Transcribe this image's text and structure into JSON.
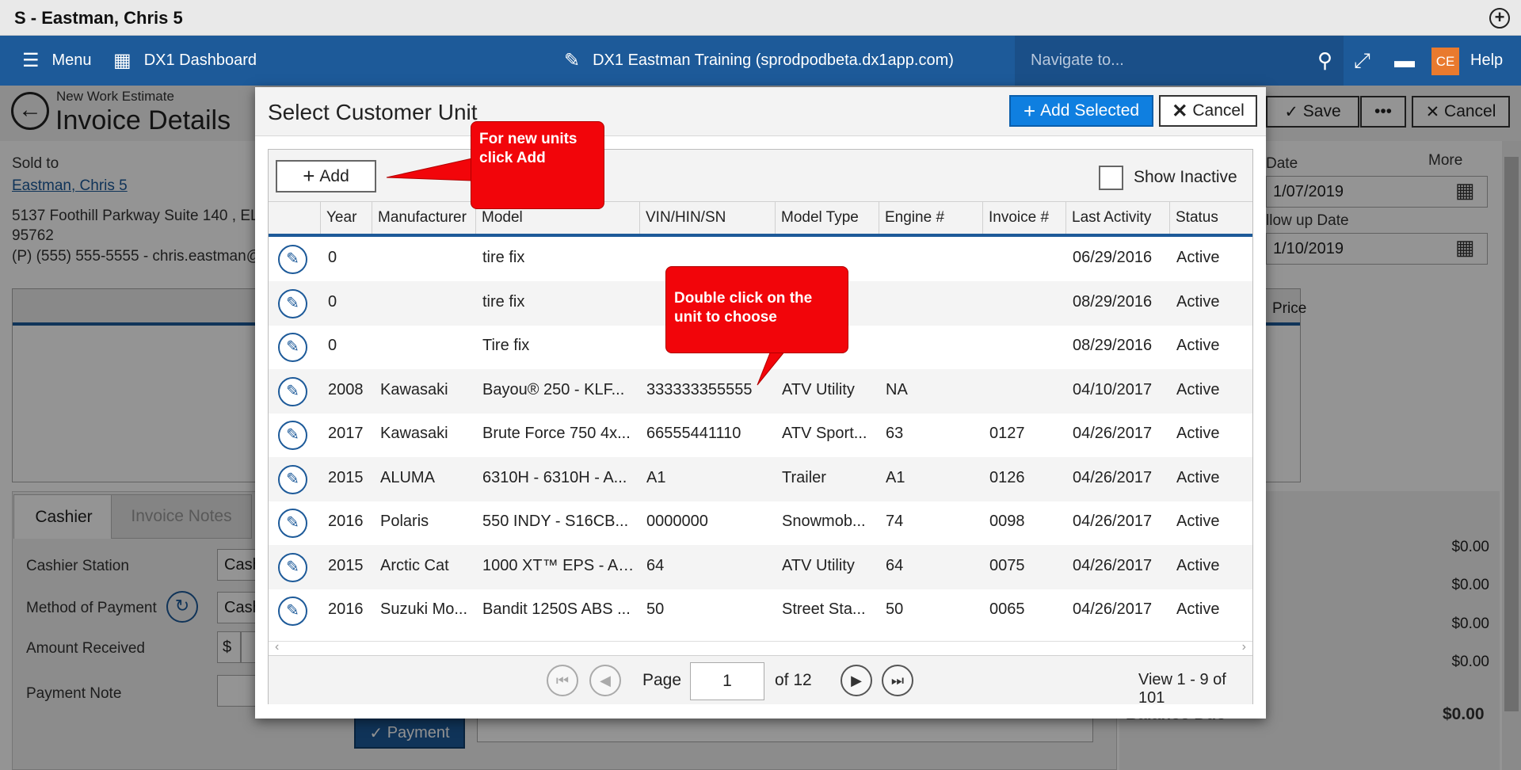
{
  "window": {
    "title": "S - Eastman, Chris 5",
    "plus_icon": "+"
  },
  "nav": {
    "menu_label": "Menu",
    "dashboard_label": "DX1 Dashboard",
    "center_label": "DX1 Eastman Training (sprodpodbeta.dx1app.com)",
    "search_placeholder": "Navigate to...",
    "avatar_initials": "CE",
    "help_label": "Help"
  },
  "page": {
    "subtitle": "New Work Estimate",
    "title": "Invoice Details",
    "save_label": "Save",
    "more_dots": "•••",
    "cancel_label": "Cancel",
    "sold_to_label": "Sold to",
    "customer_name": "Eastman, Chris 5",
    "address_line1": "5137 Foothill Parkway Suite 140 , EL",
    "address_line2": "95762",
    "phone_line": "(P) (555) 555-5555 - chris.eastman@",
    "date_label": "Date",
    "date_value": "1/07/2019",
    "followup_label": "llow up Date",
    "followup_value": "1/10/2019",
    "more_label": "More",
    "price_header": "Price",
    "tabs": {
      "cashier": "Cashier",
      "invoice_notes": "Invoice Notes"
    },
    "cashier_station_label": "Cashier Station",
    "cashier_station_value": "Cash",
    "method_label": "Method of Payment",
    "method_value": "Cash",
    "amount_label": "Amount Received",
    "amount_prefix": "$",
    "payment_note_label": "Payment Note",
    "payment_button": "Payment",
    "amounts": [
      "$0.00",
      "$0.00",
      "$0.00",
      "$0.00"
    ],
    "balance_label": "Balance Due",
    "balance_value": "$0.00"
  },
  "modal": {
    "title": "Select Customer Unit",
    "add_selected_label": "Add Selected",
    "cancel_label": "Cancel",
    "add_label": "Add",
    "show_inactive_label": "Show Inactive",
    "columns": [
      "Year",
      "Manufacturer",
      "Model",
      "VIN/HIN/SN",
      "Model Type",
      "Engine #",
      "Invoice #",
      "Last Activity",
      "Status"
    ],
    "rows": [
      {
        "year": "0",
        "manufacturer": "",
        "model": "tire fix",
        "vin": "",
        "model_type": "",
        "engine": "",
        "invoice": "",
        "last_activity": "06/29/2016",
        "status": "Active"
      },
      {
        "year": "0",
        "manufacturer": "",
        "model": "tire fix",
        "vin": "",
        "model_type": "",
        "engine": "",
        "invoice": "",
        "last_activity": "08/29/2016",
        "status": "Active"
      },
      {
        "year": "0",
        "manufacturer": "",
        "model": "Tire fix",
        "vin": "",
        "model_type": "",
        "engine": "",
        "invoice": "",
        "last_activity": "08/29/2016",
        "status": "Active"
      },
      {
        "year": "2008",
        "manufacturer": "Kawasaki",
        "model": "Bayou® 250 - KLF...",
        "vin": "333333355555",
        "model_type": "ATV Utility",
        "engine": "NA",
        "invoice": "",
        "last_activity": "04/10/2017",
        "status": "Active"
      },
      {
        "year": "2017",
        "manufacturer": "Kawasaki",
        "model": "Brute Force 750 4x...",
        "vin": "66555441110",
        "model_type": "ATV Sport...",
        "engine": "63",
        "invoice": "0127",
        "last_activity": "04/26/2017",
        "status": "Active"
      },
      {
        "year": "2015",
        "manufacturer": "ALUMA",
        "model": "6310H - 6310H - A...",
        "vin": "A1",
        "model_type": "Trailer",
        "engine": "A1",
        "invoice": "0126",
        "last_activity": "04/26/2017",
        "status": "Active"
      },
      {
        "year": "2016",
        "manufacturer": "Polaris",
        "model": "550 INDY - S16CB...",
        "vin": "0000000",
        "model_type": "Snowmob...",
        "engine": "74",
        "invoice": "0098",
        "last_activity": "04/26/2017",
        "status": "Active"
      },
      {
        "year": "2015",
        "manufacturer": "Arctic Cat",
        "model": "1000 XT™ EPS - A2...",
        "vin": "64",
        "model_type": "ATV Utility",
        "engine": "64",
        "invoice": "0075",
        "last_activity": "04/26/2017",
        "status": "Active"
      },
      {
        "year": "2016",
        "manufacturer": "Suzuki Mo...",
        "model": "Bandit 1250S ABS ...",
        "vin": "50",
        "model_type": "Street Sta...",
        "engine": "50",
        "invoice": "0065",
        "last_activity": "04/26/2017",
        "status": "Active"
      }
    ],
    "pager": {
      "page_label": "Page",
      "page_value": "1",
      "of_label": "of 12",
      "view_label": "View 1 - 9 of 101"
    }
  },
  "callouts": {
    "add_hint": "For new units click Add",
    "dblclick_hint": "Double click on the unit to choose"
  },
  "colors": {
    "nav": "#1d5a99",
    "accent": "#0f7fe0",
    "callout": "#f2050a"
  },
  "icons": [
    "menu-icon",
    "dashboard-icon",
    "pencil-icon",
    "search-icon",
    "expand-icon",
    "chat-icon",
    "back-arrow-icon",
    "calendar-icon",
    "edit-icon",
    "first-page-icon",
    "prev-page-icon",
    "next-page-icon",
    "last-page-icon"
  ]
}
